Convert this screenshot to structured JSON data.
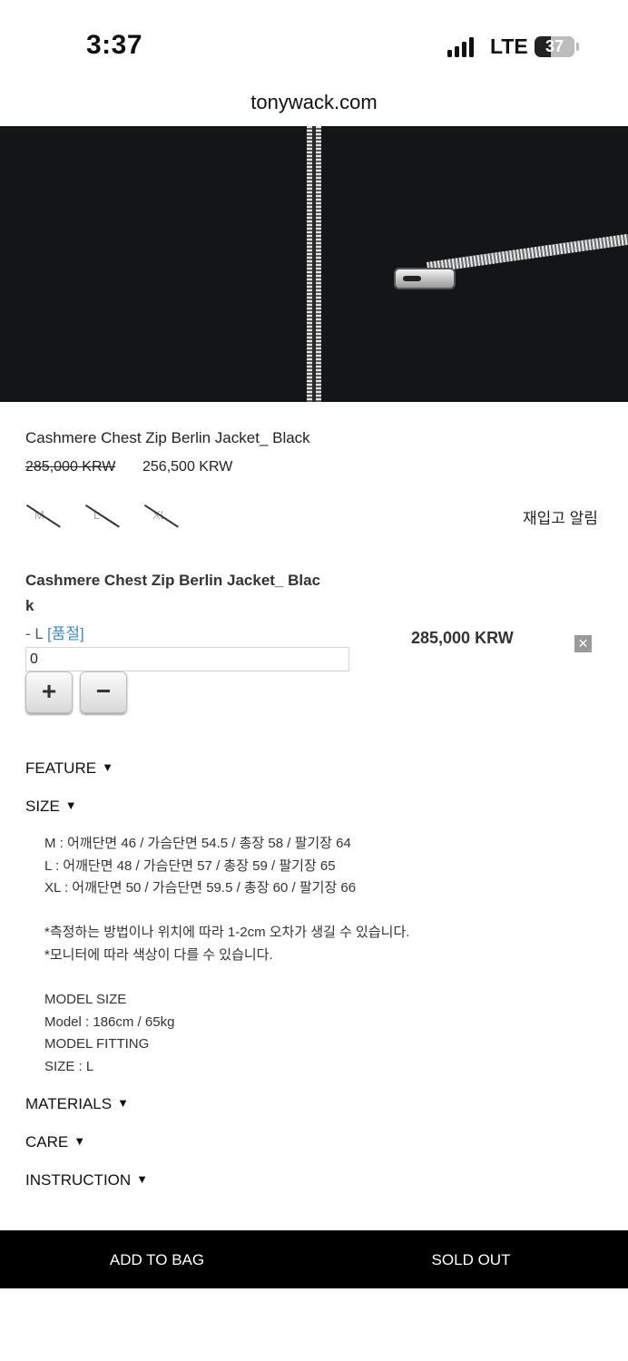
{
  "status": {
    "time": "3:37",
    "network": "LTE",
    "battery": "37"
  },
  "browser": {
    "url": "tonywack.com"
  },
  "product": {
    "name": "Cashmere Chest Zip Berlin Jacket_ Black",
    "price_original": "285,000 KRW",
    "price_sale": "256,500 KRW",
    "sizes": [
      {
        "label": "M",
        "sold_out": true
      },
      {
        "label": "L",
        "sold_out": true
      },
      {
        "label": "XL",
        "sold_out": true
      }
    ],
    "restock_alert": "재입고 알림"
  },
  "selected_option": {
    "title_line1": "Cashmere Chest Zip Berlin Jacket_ Blac",
    "title_line2": "k",
    "dash": "- L",
    "status": "[품절]",
    "quantity": "0",
    "plus": "+",
    "minus": "−",
    "price": "285,000 KRW",
    "delete_icon": "✕"
  },
  "sections": {
    "feature": "FEATURE",
    "size": "SIZE",
    "materials": "MATERIALS",
    "care": "CARE",
    "instruction": "INSTRUCTION",
    "arrow": "▼"
  },
  "size_info": {
    "m": "M : 어깨단면 46 / 가슴단면 54.5 / 총장 58 / 팔기장 64",
    "l": "L : 어깨단면 48 / 가슴단면 57 / 총장 59 / 팔기장 65",
    "xl": "XL : 어깨단면 50 / 가슴단면 59.5 / 총장 60 / 팔기장 66",
    "note1": "*측정하는 방법이나 위치에 따라 1-2cm 오차가 생길 수 있습니다.",
    "note2": "*모니터에 따라 색상이 다를 수 있습니다.",
    "model_size_heading": "MODEL SIZE",
    "model": "Model : 186cm / 65kg",
    "model_fitting_heading": "MODEL FITTING",
    "fitting_size": "SIZE : L"
  },
  "actions": {
    "add_to_bag": "ADD TO BAG",
    "sold_out": "SOLD OUT"
  },
  "colors": {
    "link_blue": "#3c8dcc",
    "bar_black": "#000000"
  }
}
